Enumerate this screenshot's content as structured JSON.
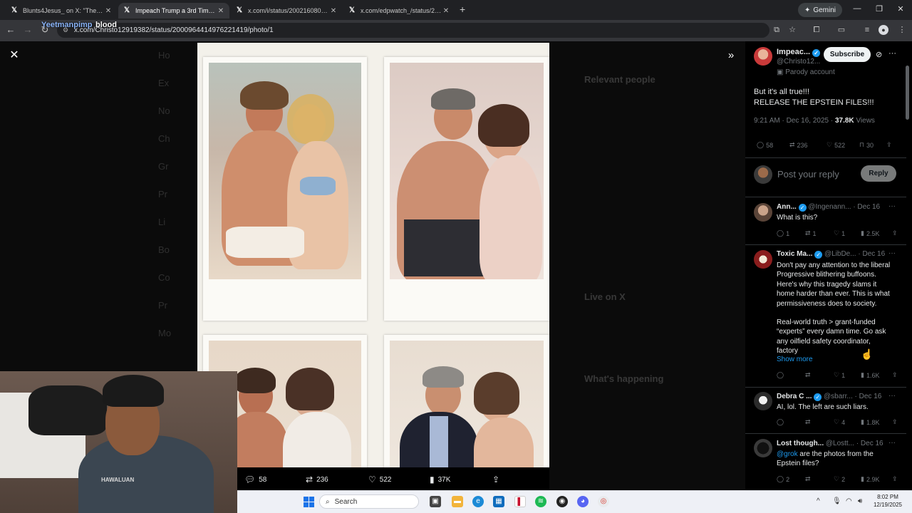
{
  "browser": {
    "tabs": [
      {
        "title": "Blunts4Jesus_ on X: \"The face o"
      },
      {
        "title": "Impeach Trump a 3rd Time! on"
      },
      {
        "title": "x.com/i/status/2002160805052"
      },
      {
        "title": "x.com/edpwatch_/status/20017"
      }
    ],
    "gemini_label": "Gemini",
    "url": "x.com/Christo12919382/status/2000964414976221419/photo/1",
    "overlay_name": "Yeetmanpimp",
    "overlay_word": "blood"
  },
  "background_feed": {
    "sidebar_items": [
      "Ho",
      "Ex",
      "No",
      "Ch",
      "Gr",
      "Pr",
      "Li",
      "Bo",
      "Co",
      "Pr",
      "Mo"
    ],
    "relevant_people_title": "Relevant people",
    "live_title": "Live on X",
    "happening_title": "What's happening"
  },
  "media": {
    "stats": {
      "replies": "58",
      "reposts": "236",
      "likes": "522",
      "views": "37K"
    }
  },
  "webcam": {
    "shirt_text": "HAWALUAN"
  },
  "taskbar": {
    "search_placeholder": "Search",
    "time": "8:02 PM",
    "date": "12/19/2025"
  },
  "post": {
    "author_name": "Impeac...",
    "author_handle": "@Christo12...",
    "subscribe_label": "Subscribe",
    "parody_label": "Parody account",
    "text_line1": "But it's all true!!!",
    "text_line2": "RELEASE THE EPSTEIN FILES!!!",
    "timestamp": "9:21 AM · Dec 16, 2025 ·",
    "views_count": "37.8K",
    "views_label": "Views",
    "stats": {
      "replies": "58",
      "reposts": "236",
      "likes": "522",
      "bookmarks": "30"
    },
    "reply_placeholder": "Post your reply",
    "reply_button": "Reply"
  },
  "replies": [
    {
      "name": "Ann...",
      "handle": "@Ingenann...",
      "date": "· Dec 16",
      "lines": [
        "What is this?"
      ],
      "stats": {
        "replies": "1",
        "reposts": "1",
        "likes": "1",
        "views": "2.5K"
      }
    },
    {
      "name": "Toxic Ma...",
      "handle": "@LibDe...",
      "date": "· Dec 16",
      "lines": [
        "Don't pay any attention to the liberal",
        "Progressive blithering buffoons.",
        "Here's why this tragedy slams it",
        "home harder than ever. This is what",
        "permissiveness does to society.",
        "",
        "Real-world truth > grant-funded",
        "“experts” every damn time. Go ask",
        "any oilfield safety coordinator,",
        "factory"
      ],
      "show_more": "Show more",
      "stats": {
        "replies": "",
        "reposts": "",
        "likes": "1",
        "views": "1.6K"
      }
    },
    {
      "name": "Debra C ...",
      "handle": "@sbarr...",
      "date": "· Dec 16",
      "lines": [
        "AI, lol. The left are such liars."
      ],
      "stats": {
        "replies": "",
        "reposts": "",
        "likes": "4",
        "views": "1.8K"
      }
    },
    {
      "name": "Lost though...",
      "handle": "@Lostt...",
      "date": "· Dec 16",
      "mention": "@grok",
      "line_after_mention": " are the photos from the",
      "lines": [
        "Epstein files?"
      ],
      "stats": {
        "replies": "2",
        "reposts": "",
        "likes": "2",
        "views": "2.9K"
      }
    }
  ],
  "colors": {
    "x_blue": "#1d9bf0",
    "background": "#000000",
    "muted_text": "#71767b"
  }
}
